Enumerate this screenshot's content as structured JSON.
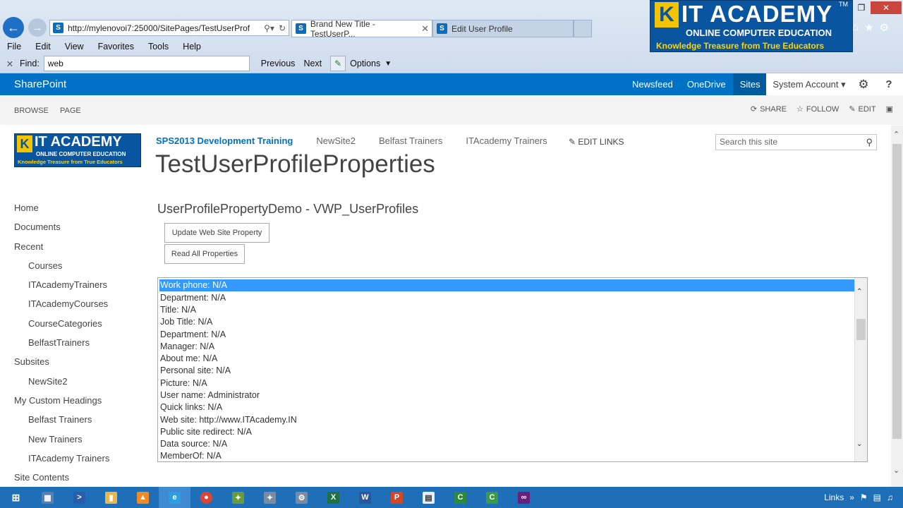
{
  "browser": {
    "url": "http://mylenovoi7:25000/SitePages/TestUserProf",
    "tabs": [
      {
        "label": "Brand New Title - TestUserP..."
      },
      {
        "label": "Edit User Profile"
      }
    ],
    "menu": [
      "File",
      "Edit",
      "View",
      "Favorites",
      "Tools",
      "Help"
    ],
    "find": {
      "label": "Find:",
      "value": "web",
      "previous": "Previous",
      "next": "Next",
      "options": "Options"
    }
  },
  "watermark": {
    "title": "IT ACADEMY",
    "tm": "TM",
    "subtitle": "ONLINE COMPUTER EDUCATION",
    "tagline": "Knowledge Treasure from True Educators"
  },
  "suitebar": {
    "brand": "SharePoint",
    "links": [
      "Newsfeed",
      "OneDrive",
      "Sites"
    ],
    "account": "System Account ▾"
  },
  "ribbon": {
    "tabs": [
      "BROWSE",
      "PAGE"
    ],
    "actions": {
      "share": "SHARE",
      "follow": "FOLLOW",
      "edit": "EDIT"
    }
  },
  "header": {
    "logo": {
      "title": "IT ACADEMY",
      "subtitle": "ONLINE COMPUTER EDUCATION",
      "tagline": "Knowledge Treasure from True Educators"
    },
    "topnav": [
      "SPS2013 Development Training",
      "NewSite2",
      "Belfast Trainers",
      "ITAcademy Trainers"
    ],
    "edit_links": "EDIT LINKS",
    "search_placeholder": "Search this site",
    "page_title": "TestUserProfileProperties"
  },
  "leftnav": [
    {
      "label": "Home",
      "level": 0
    },
    {
      "label": "Documents",
      "level": 0
    },
    {
      "label": "Recent",
      "level": 0
    },
    {
      "label": "Courses",
      "level": 1
    },
    {
      "label": "ITAcademyTrainers",
      "level": 1
    },
    {
      "label": "ITAcademyCourses",
      "level": 1
    },
    {
      "label": "CourseCategories",
      "level": 1
    },
    {
      "label": "BelfastTrainers",
      "level": 1
    },
    {
      "label": "Subsites",
      "level": 0
    },
    {
      "label": "NewSite2",
      "level": 1
    },
    {
      "label": "My Custom Headings",
      "level": 0
    },
    {
      "label": "Belfast Trainers",
      "level": 1
    },
    {
      "label": "New Trainers",
      "level": 1
    },
    {
      "label": "ITAcademy Trainers",
      "level": 1
    },
    {
      "label": "Site Contents",
      "level": 0
    }
  ],
  "webpart": {
    "title": "UserProfilePropertyDemo - VWP_UserProfiles",
    "update_button": "Update Web Site Property",
    "read_button": "Read All Properties",
    "list": [
      "Work phone: N/A",
      "Department: N/A",
      "Title: N/A",
      "Job Title: N/A",
      "Department: N/A",
      "Manager: N/A",
      "About me: N/A",
      "Personal site: N/A",
      "Picture: N/A",
      "User name: Administrator",
      "Quick links: N/A",
      "Web site: http://www.ITAcademy.IN",
      "Public site redirect: N/A",
      "Data source: N/A",
      "MemberOf: N/A"
    ],
    "selected_index": 0
  },
  "taskbar": {
    "apps": [
      "windows-start",
      "explorer-files",
      "powershell",
      "file-explorer",
      "vlc",
      "internet-explorer",
      "chrome",
      "sharepoint-designer",
      "tools",
      "settings-tool",
      "excel",
      "word",
      "powerpoint",
      "notepad",
      "camtasia-recorder",
      "camtasia-studio",
      "visual-studio"
    ],
    "active_index": 5,
    "tray_links": "Links"
  },
  "colors": {
    "suite_blue": "#0072c6",
    "selected_blue": "#3399ff",
    "taskbar": "#1e6fb8"
  }
}
